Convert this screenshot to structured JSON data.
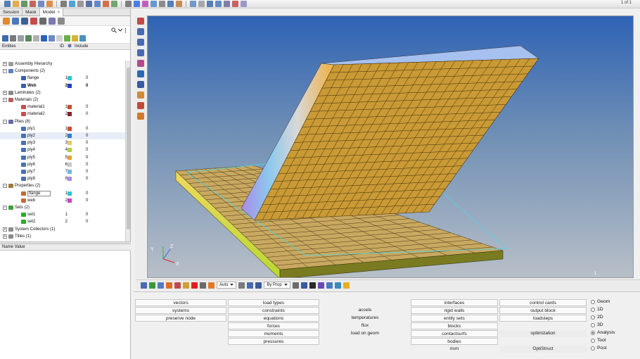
{
  "toolbar": {
    "page_indicator": "1 of 1"
  },
  "tabs": [
    {
      "label": "Session"
    },
    {
      "label": "Mask"
    },
    {
      "label": "Model",
      "close": "×"
    }
  ],
  "columns": {
    "entities": "Entities",
    "id": "ID",
    "include": "Include"
  },
  "tree": [
    {
      "label": "Assembly Hierarchy",
      "indent": 0,
      "toggle": "+",
      "icon_color": "#9a9a9a"
    },
    {
      "label": "Components (2)",
      "indent": 0,
      "toggle": "−",
      "icon_color": "#5a7fbf"
    },
    {
      "label": "flange",
      "indent": 2,
      "id": "1",
      "color": "#2ec4d6",
      "include": "0",
      "icon_color": "#3b5fa8"
    },
    {
      "label": "Web",
      "indent": 2,
      "id": "2",
      "color": "#1e3fc8",
      "include": "0",
      "bold": true,
      "icon_color": "#3b5fa8"
    },
    {
      "label": "Laminates (2)",
      "indent": 0,
      "toggle": "+",
      "icon_color": "#8a8a8a"
    },
    {
      "label": "Materials (2)",
      "indent": 0,
      "toggle": "−",
      "icon_color": "#b06060"
    },
    {
      "label": "material1",
      "indent": 2,
      "id": "1",
      "color": "#d14a2a",
      "include": "0",
      "icon_color": "#c05050"
    },
    {
      "label": "material2",
      "indent": 2,
      "id": "2",
      "color": "#8b1e2a",
      "include": "0",
      "icon_color": "#c05050"
    },
    {
      "label": "Plies (8)",
      "indent": 0,
      "toggle": "−",
      "icon_color": "#6a6aa0"
    },
    {
      "label": "ply1",
      "indent": 2,
      "id": "1",
      "color": "#d9472f",
      "include": "0",
      "icon_color": "#4c6fb0"
    },
    {
      "label": "ply2",
      "indent": 2,
      "id": "2",
      "color": "#2f7bd9",
      "include": "0",
      "icon_color": "#4c6fb0",
      "selected": true
    },
    {
      "label": "ply3",
      "indent": 2,
      "id": "3",
      "color": "#e6c96a",
      "include": "0",
      "icon_color": "#4c6fb0"
    },
    {
      "label": "ply4",
      "indent": 2,
      "id": "4",
      "color": "#a8d04a",
      "include": "0",
      "icon_color": "#4c6fb0"
    },
    {
      "label": "ply5",
      "indent": 2,
      "id": "5",
      "color": "#e8a13a",
      "include": "0",
      "icon_color": "#4c6fb0"
    },
    {
      "label": "ply6",
      "indent": 2,
      "id": "6",
      "color": "#c8c8c8",
      "include": "0",
      "icon_color": "#4c6fb0"
    },
    {
      "label": "ply7",
      "indent": 2,
      "id": "7",
      "color": "#6fb6e0",
      "include": "0",
      "icon_color": "#4c6fb0"
    },
    {
      "label": "ply8",
      "indent": 2,
      "id": "8",
      "color": "#a98ae8",
      "include": "0",
      "icon_color": "#4c6fb0"
    },
    {
      "label": "Properties (2)",
      "indent": 0,
      "toggle": "−",
      "icon_color": "#a07a3a"
    },
    {
      "label": "flange",
      "indent": 2,
      "id": "1",
      "color": "#2ec4d6",
      "include": "0",
      "icon_color": "#c06a3a",
      "boxed": true
    },
    {
      "label": "web",
      "indent": 2,
      "id": "2",
      "color": "#d63ac8",
      "include": "0",
      "icon_color": "#c06a3a"
    },
    {
      "label": "Sets (2)",
      "indent": 0,
      "toggle": "−",
      "icon_color": "#3aa03a"
    },
    {
      "label": "set1",
      "indent": 2,
      "id": "1",
      "include": "0",
      "icon_color": "#2fa82f"
    },
    {
      "label": "set2",
      "indent": 2,
      "id": "2",
      "include": "0",
      "icon_color": "#2fa82f"
    },
    {
      "label": "System Collectors (1)",
      "indent": 0,
      "toggle": "+",
      "icon_color": "#8a8a8a"
    },
    {
      "label": "Titles (1)",
      "indent": 0,
      "toggle": "+",
      "icon_color": "#8a8a8a"
    }
  ],
  "name_value_header": "Name Value",
  "bottom_toolbar": {
    "auto_label": "Auto",
    "by_prop_label": "By Prop"
  },
  "axes": {
    "x": "X",
    "y": "Y",
    "z": "Z"
  },
  "viewport_page": "1",
  "menu": {
    "col1": [
      "vectors",
      "systems",
      "preserve node"
    ],
    "col2": [
      "load types",
      "constraints",
      "equations",
      "forces",
      "moments",
      "pressures"
    ],
    "col3": [
      "accels",
      "temperatures",
      "flux",
      "load on geom"
    ],
    "col4": [
      "interfaces",
      "rigid walls",
      "entity sets",
      "blocks",
      "contactsurfs",
      "bodies",
      "nsm"
    ],
    "col5": [
      "control cards",
      "output block",
      "loadsteps",
      "optimization",
      "OptiStruct"
    ]
  },
  "radios": [
    {
      "label": "Geom",
      "on": false
    },
    {
      "label": "1D",
      "on": false
    },
    {
      "label": "2D",
      "on": false
    },
    {
      "label": "3D",
      "on": false
    },
    {
      "label": "Analysis",
      "on": true
    },
    {
      "label": "Tool",
      "on": false
    },
    {
      "label": "Post",
      "on": false
    }
  ]
}
